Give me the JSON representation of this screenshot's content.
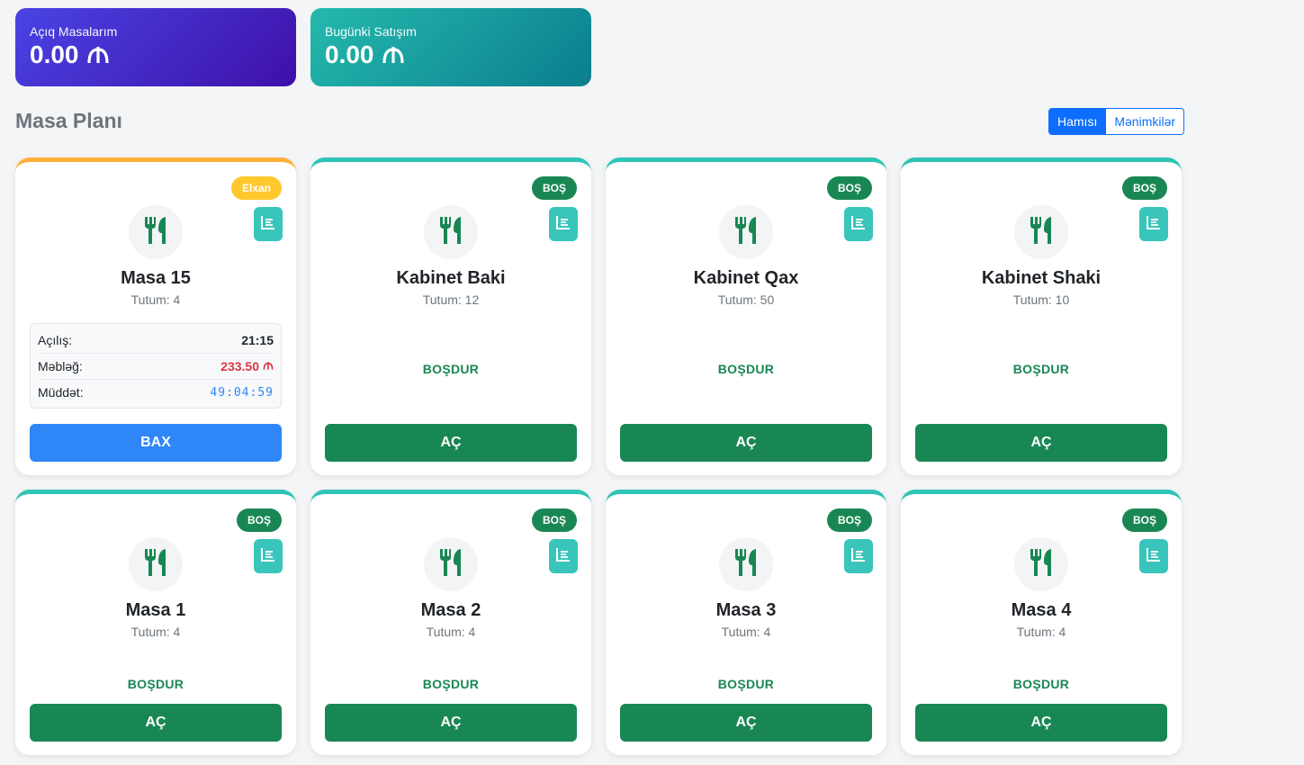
{
  "stats": [
    {
      "label": "Açıq Masalarım",
      "value": "0.00"
    },
    {
      "label": "Bugünki Satışım",
      "value": "0.00"
    }
  ],
  "section_title": "Masa Planı",
  "filter": {
    "all": "Hamısı",
    "mine": "Mənimkilər"
  },
  "busy_table": {
    "badge": "Elxan",
    "name": "Masa 15",
    "capacity": "Tutum: 4",
    "open_label": "Açılış:",
    "open_value": "21:15",
    "amount_label": "Məbləğ:",
    "amount_value": "233.50",
    "duration_label": "Müddət:",
    "duration_value": "49:04:59",
    "action": "BAX"
  },
  "free_tables": [
    {
      "badge": "BOŞ",
      "name": "Kabinet Baki",
      "capacity": "Tutum: 12",
      "status": "BOŞDUR",
      "action": "AÇ"
    },
    {
      "badge": "BOŞ",
      "name": "Kabinet Qax",
      "capacity": "Tutum: 50",
      "status": "BOŞDUR",
      "action": "AÇ"
    },
    {
      "badge": "BOŞ",
      "name": "Kabinet Shaki",
      "capacity": "Tutum: 10",
      "status": "BOŞDUR",
      "action": "AÇ"
    },
    {
      "badge": "BOŞ",
      "name": "Masa 1",
      "capacity": "Tutum: 4",
      "status": "BOŞDUR",
      "action": "AÇ"
    },
    {
      "badge": "BOŞ",
      "name": "Masa 2",
      "capacity": "Tutum: 4",
      "status": "BOŞDUR",
      "action": "AÇ"
    },
    {
      "badge": "BOŞ",
      "name": "Masa 3",
      "capacity": "Tutum: 4",
      "status": "BOŞDUR",
      "action": "AÇ"
    },
    {
      "badge": "BOŞ",
      "name": "Masa 4",
      "capacity": "Tutum: 4",
      "status": "BOŞDUR",
      "action": "AÇ"
    }
  ],
  "colors": {
    "success": "#198754",
    "teal": "#2ec4b6",
    "primary": "#0d6efd",
    "warning": "#ffc82c"
  },
  "icons": {
    "table": "utensils-icon",
    "menu": "list-icon",
    "currency": "manat-icon"
  }
}
